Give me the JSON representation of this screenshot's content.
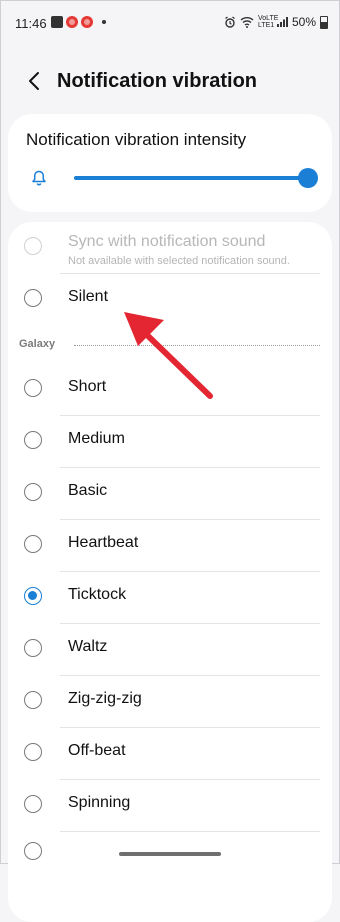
{
  "status_bar": {
    "time": "11:46",
    "network_top": "VoLTE",
    "network_bottom": "LTE1",
    "battery": "50%"
  },
  "header": {
    "title": "Notification vibration"
  },
  "intensity": {
    "label": "Notification vibration intensity",
    "level_percent": 100
  },
  "options": [
    {
      "label": "Sync with notification sound",
      "sub": "Not available with selected notification sound.",
      "disabled": true
    },
    {
      "label": "Silent"
    }
  ],
  "section": {
    "label": "Galaxy"
  },
  "galaxy_options": [
    {
      "label": "Short"
    },
    {
      "label": "Medium"
    },
    {
      "label": "Basic"
    },
    {
      "label": "Heartbeat"
    },
    {
      "label": "Ticktock",
      "selected": true
    },
    {
      "label": "Waltz"
    },
    {
      "label": "Zig-zig-zig"
    },
    {
      "label": "Off-beat"
    },
    {
      "label": "Spinning"
    }
  ],
  "colors": {
    "accent": "#1b7fd6",
    "annotation_arrow": "#e32631"
  }
}
